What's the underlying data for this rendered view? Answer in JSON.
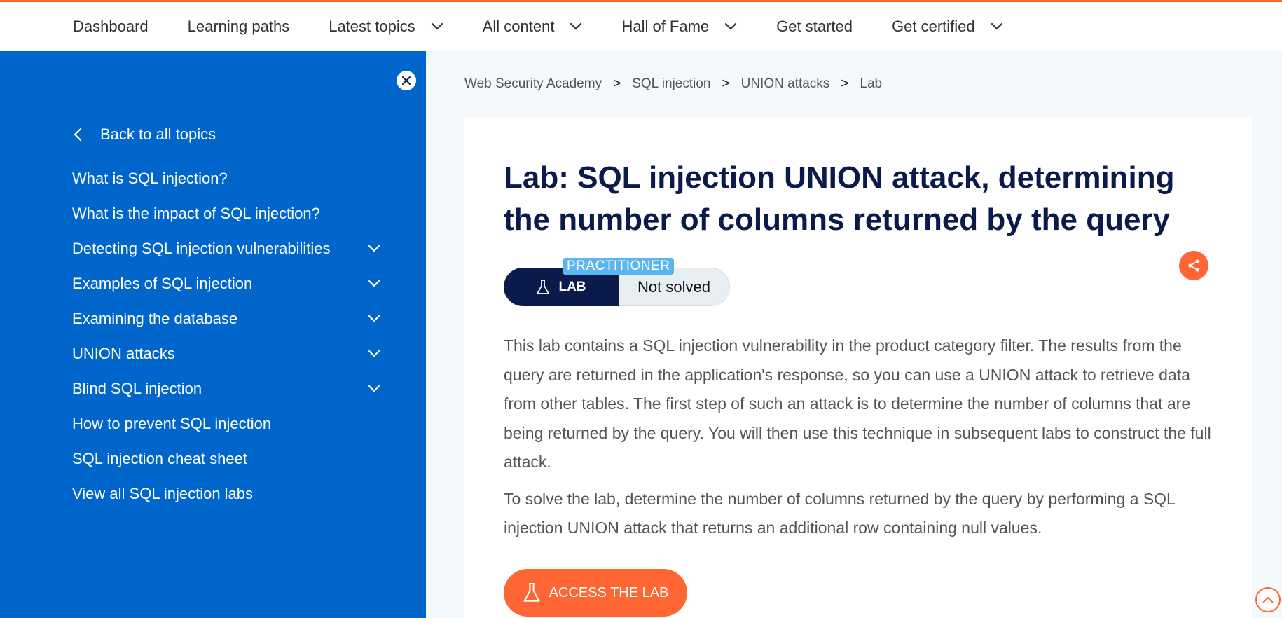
{
  "nav": {
    "items": [
      {
        "label": "Dashboard",
        "dropdown": false
      },
      {
        "label": "Learning paths",
        "dropdown": false
      },
      {
        "label": "Latest topics",
        "dropdown": true
      },
      {
        "label": "All content",
        "dropdown": true
      },
      {
        "label": "Hall of Fame",
        "dropdown": true
      },
      {
        "label": "Get started",
        "dropdown": false
      },
      {
        "label": "Get certified",
        "dropdown": true
      }
    ]
  },
  "sidebar": {
    "back_label": "Back to all topics",
    "items": [
      {
        "label": "What is SQL injection?",
        "expandable": false
      },
      {
        "label": "What is the impact of SQL injection?",
        "expandable": false
      },
      {
        "label": "Detecting SQL injection vulnerabilities",
        "expandable": true
      },
      {
        "label": "Examples of SQL injection",
        "expandable": true
      },
      {
        "label": "Examining the database",
        "expandable": true
      },
      {
        "label": "UNION attacks",
        "expandable": true
      },
      {
        "label": "Blind SQL injection",
        "expandable": true
      },
      {
        "label": "How to prevent SQL injection",
        "expandable": false
      },
      {
        "label": "SQL injection cheat sheet",
        "expandable": false
      },
      {
        "label": "View all SQL injection labs",
        "expandable": false
      }
    ]
  },
  "breadcrumb": {
    "items": [
      "Web Security Academy",
      "SQL injection",
      "UNION attacks",
      "Lab"
    ],
    "separator": ">"
  },
  "lab": {
    "title": "Lab: SQL injection UNION attack, determining the number of columns returned by the query",
    "badge_label": "LAB",
    "level": "PRACTITIONER",
    "status": "Not solved",
    "paragraphs": [
      "This lab contains a SQL injection vulnerability in the product category filter. The results from the query are returned in the application's response, so you can use a UNION attack to retrieve data from other tables. The first step of such an attack is to determine the number of columns that are being returned by the query. You will then use this technique in subsequent labs to construct the full attack.",
      "To solve the lab, determine the number of columns returned by the query by performing a SQL injection UNION attack that returns an additional row containing null values."
    ],
    "access_label": "ACCESS THE LAB"
  },
  "colors": {
    "accent": "#ff6633",
    "sidebar": "#0066cc",
    "navy": "#0a1a4a",
    "level_badge": "#5ab6f0"
  }
}
